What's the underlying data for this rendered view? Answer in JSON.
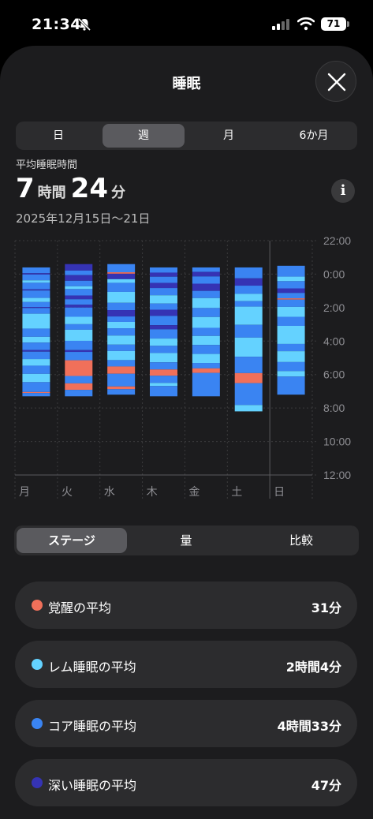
{
  "status_bar": {
    "time": "21:34",
    "battery": "71"
  },
  "header": {
    "title": "睡眠"
  },
  "period_tabs": [
    {
      "label": "日",
      "selected": false
    },
    {
      "label": "週",
      "selected": true
    },
    {
      "label": "月",
      "selected": false
    },
    {
      "label": "6か月",
      "selected": false
    }
  ],
  "summary": {
    "label": "平均睡眠時間",
    "hours": "7",
    "hours_unit": "時間",
    "minutes": "24",
    "minutes_unit": "分",
    "date_range": "2025年12月15日〜21日"
  },
  "chart_data": {
    "type": "bar",
    "categories": [
      "月",
      "火",
      "水",
      "木",
      "金",
      "土",
      "日"
    ],
    "y_ticks": [
      "22:00",
      "0:00",
      "2:00",
      "4:00",
      "6:00",
      "8:00",
      "10:00",
      "12:00"
    ],
    "ylim": [
      -2,
      12
    ],
    "stage_colors": {
      "awake": "#f0705a",
      "rem": "#64d2ff",
      "core": "#3a84f2",
      "deep": "#3533b4"
    },
    "days": [
      {
        "day": "月",
        "start": -0.4,
        "end": 7.3,
        "segments": [
          [
            "core",
            0.35
          ],
          [
            "deep",
            0.08
          ],
          [
            "core",
            0.35
          ],
          [
            "rem",
            0.15
          ],
          [
            "core",
            0.4
          ],
          [
            "deep",
            0.07
          ],
          [
            "core",
            0.45
          ],
          [
            "rem",
            0.25
          ],
          [
            "core",
            0.3
          ],
          [
            "deep",
            0.06
          ],
          [
            "core",
            0.35
          ],
          [
            "rem",
            0.9
          ],
          [
            "core",
            0.5
          ],
          [
            "rem",
            0.35
          ],
          [
            "core",
            0.45
          ],
          [
            "deep",
            0.1
          ],
          [
            "core",
            0.45
          ],
          [
            "rem",
            0.4
          ],
          [
            "core",
            0.5
          ],
          [
            "rem",
            0.5
          ],
          [
            "core",
            0.6
          ],
          [
            "awake",
            0.06
          ],
          [
            "core",
            0.2
          ]
        ]
      },
      {
        "day": "火",
        "start": -0.6,
        "end": 7.3,
        "segments": [
          [
            "deep",
            0.35
          ],
          [
            "core",
            0.25
          ],
          [
            "deep",
            0.3
          ],
          [
            "core",
            0.3
          ],
          [
            "rem",
            0.15
          ],
          [
            "core",
            0.35
          ],
          [
            "deep",
            0.2
          ],
          [
            "core",
            0.3
          ],
          [
            "deep",
            0.15
          ],
          [
            "core",
            0.5
          ],
          [
            "rem",
            0.4
          ],
          [
            "core",
            0.3
          ],
          [
            "rem",
            0.6
          ],
          [
            "core",
            0.5
          ],
          [
            "deep",
            0.1
          ],
          [
            "core",
            0.45
          ],
          [
            "awake",
            0.85
          ],
          [
            "core",
            0.4
          ],
          [
            "awake",
            0.35
          ],
          [
            "core",
            0.35
          ]
        ]
      },
      {
        "day": "水",
        "start": -0.6,
        "end": 7.2,
        "segments": [
          [
            "core",
            0.45
          ],
          [
            "awake",
            0.08
          ],
          [
            "deep",
            0.3
          ],
          [
            "rem",
            0.2
          ],
          [
            "core",
            0.5
          ],
          [
            "rem",
            0.6
          ],
          [
            "core",
            0.4
          ],
          [
            "deep",
            0.35
          ],
          [
            "core",
            0.3
          ],
          [
            "rem",
            0.35
          ],
          [
            "core",
            0.4
          ],
          [
            "rem",
            0.5
          ],
          [
            "core",
            0.35
          ],
          [
            "rem",
            0.5
          ],
          [
            "core",
            0.35
          ],
          [
            "awake",
            0.4
          ],
          [
            "core",
            0.7
          ],
          [
            "awake",
            0.15
          ],
          [
            "core",
            0.3
          ]
        ]
      },
      {
        "day": "木",
        "start": -0.4,
        "end": 7.3,
        "segments": [
          [
            "core",
            0.25
          ],
          [
            "deep",
            0.2
          ],
          [
            "core",
            0.3
          ],
          [
            "deep",
            0.25
          ],
          [
            "core",
            0.35
          ],
          [
            "rem",
            0.4
          ],
          [
            "core",
            0.3
          ],
          [
            "deep",
            0.3
          ],
          [
            "core",
            0.45
          ],
          [
            "deep",
            0.2
          ],
          [
            "core",
            0.45
          ],
          [
            "rem",
            0.35
          ],
          [
            "core",
            0.35
          ],
          [
            "rem",
            0.45
          ],
          [
            "core",
            0.35
          ],
          [
            "awake",
            0.3
          ],
          [
            "core",
            0.35
          ],
          [
            "rem",
            0.15
          ],
          [
            "core",
            0.5
          ]
        ]
      },
      {
        "day": "金",
        "start": -0.4,
        "end": 7.3,
        "segments": [
          [
            "core",
            0.25
          ],
          [
            "deep",
            0.25
          ],
          [
            "core",
            0.4
          ],
          [
            "deep",
            0.4
          ],
          [
            "core",
            0.4
          ],
          [
            "rem",
            0.55
          ],
          [
            "core",
            0.5
          ],
          [
            "rem",
            0.6
          ],
          [
            "core",
            0.45
          ],
          [
            "rem",
            0.5
          ],
          [
            "core",
            0.5
          ],
          [
            "rem",
            0.5
          ],
          [
            "core",
            0.3
          ],
          [
            "awake",
            0.25
          ],
          [
            "core",
            1.3
          ]
        ]
      },
      {
        "day": "土",
        "start": -0.4,
        "end": 8.2,
        "segments": [
          [
            "core",
            0.6
          ],
          [
            "deep",
            0.4
          ],
          [
            "core",
            0.45
          ],
          [
            "rem",
            0.4
          ],
          [
            "core",
            0.3
          ],
          [
            "rem",
            1.0
          ],
          [
            "core",
            0.7
          ],
          [
            "rem",
            1.05
          ],
          [
            "core",
            0.9
          ],
          [
            "awake",
            0.55
          ],
          [
            "core",
            1.2
          ],
          [
            "rem",
            0.35
          ]
        ]
      },
      {
        "day": "日",
        "start": -0.5,
        "end": 7.2,
        "segments": [
          [
            "core",
            0.6
          ],
          [
            "rem",
            0.25
          ],
          [
            "core",
            0.4
          ],
          [
            "deep",
            0.25
          ],
          [
            "core",
            0.3
          ],
          [
            "awake",
            0.07
          ],
          [
            "core",
            0.4
          ],
          [
            "rem",
            0.55
          ],
          [
            "core",
            0.5
          ],
          [
            "rem",
            1.0
          ],
          [
            "core",
            0.4
          ],
          [
            "rem",
            0.6
          ],
          [
            "core",
            0.5
          ],
          [
            "rem",
            0.3
          ],
          [
            "core",
            1.0
          ]
        ]
      }
    ]
  },
  "metric_tabs": [
    {
      "label": "ステージ",
      "selected": true
    },
    {
      "label": "量",
      "selected": false
    },
    {
      "label": "比較",
      "selected": false
    }
  ],
  "stats": [
    {
      "label": "覚醒の平均",
      "value": "31分",
      "color": "#f0705a"
    },
    {
      "label": "レム睡眠の平均",
      "value": "2時間4分",
      "color": "#64d2ff"
    },
    {
      "label": "コア睡眠の平均",
      "value": "4時間33分",
      "color": "#3a84f2"
    },
    {
      "label": "深い睡眠の平均",
      "value": "47分",
      "color": "#3533b4"
    }
  ]
}
